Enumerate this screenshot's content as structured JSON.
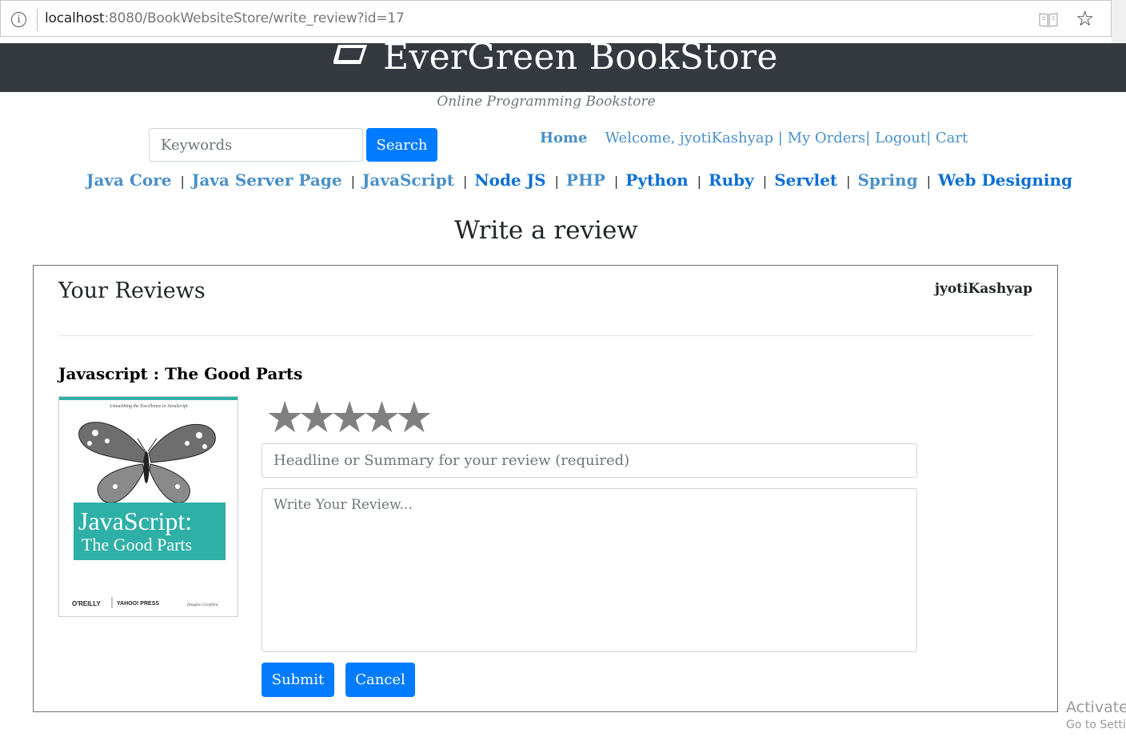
{
  "browser": {
    "url_host": "localhost",
    "url_rest": ":8080/BookWebsiteStore/write_review?id=17"
  },
  "header": {
    "title": "EverGreen BookStore",
    "tagline": "Online Programming Bookstore",
    "background_color": "#343a40"
  },
  "search": {
    "placeholder": "Keywords",
    "button_label": "Search"
  },
  "user_nav": {
    "home": "Home",
    "welcome": "Welcome, jyotiKashyap",
    "sep1": " | ",
    "my_orders": "My Orders",
    "sep2": "| ",
    "logout": "Logout",
    "sep3": "| ",
    "cart": "Cart"
  },
  "categories": [
    {
      "label": "Java Core"
    },
    {
      "label": "Java Server Page"
    },
    {
      "label": "JavaScript"
    },
    {
      "label": "Node JS"
    },
    {
      "label": "PHP"
    },
    {
      "label": "Python"
    },
    {
      "label": "Ruby"
    },
    {
      "label": "Servlet"
    },
    {
      "label": "Spring"
    },
    {
      "label": "Web Designing"
    }
  ],
  "category_separator": "|",
  "page": {
    "heading": "Write a review"
  },
  "review": {
    "section_title": "Your Reviews",
    "username": "jyotiKashyap",
    "book_title": "Javascript : The Good Parts",
    "rating_stars": "★★★★★",
    "rating_value": 0,
    "rating_max": 5,
    "headline_placeholder": "Headline or Summary for your review (required)",
    "comment_placeholder": "Write Your Review...",
    "submit_label": "Submit",
    "cancel_label": "Cancel"
  },
  "book_cover": {
    "top_line": "Unearthing the Excellence in JavaScript",
    "title_line1": "JavaScript:",
    "title_line2": "The Good Parts",
    "publisher": "O'REILLY",
    "press": "YAHOO! PRESS",
    "author": "Douglas Crockford",
    "band_color": "#2eb0a6"
  },
  "watermark": {
    "line1": "Activate",
    "line2": "Go to Settin"
  },
  "colors": {
    "primary_button": "#007bff",
    "link": "#4a90c8",
    "star": "#808080"
  }
}
